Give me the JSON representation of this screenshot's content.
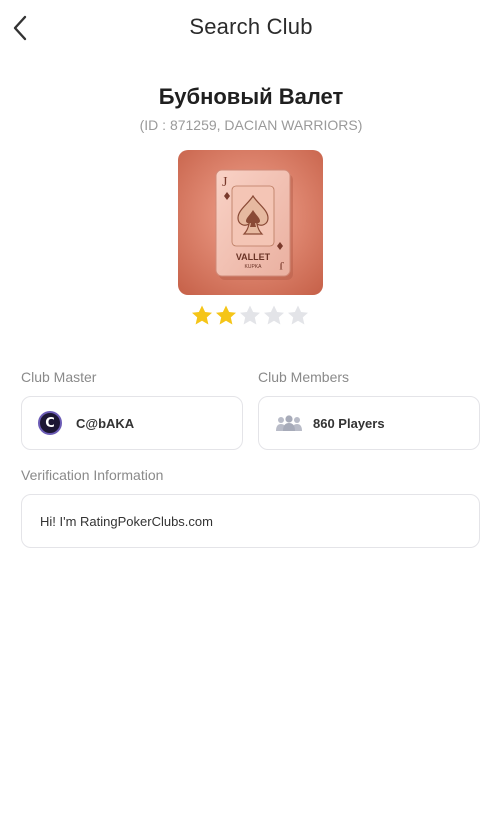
{
  "header": {
    "title": "Search Club"
  },
  "club": {
    "name": "Бубновый Валет",
    "id_line": "(ID : 871259, DACIAN WARRIORS)",
    "image_text": "VALLET",
    "image_subtext": "KUPKA",
    "rating": 2,
    "rating_max": 5
  },
  "master": {
    "label": "Club Master",
    "name": "C@bAKA",
    "avatar_letter": "C"
  },
  "members": {
    "label": "Club Members",
    "count": "860 Players"
  },
  "verification": {
    "label": "Verification Information",
    "text": "Hi! I'm RatingPokerClubs.com"
  },
  "colors": {
    "star_filled": "#f5c518",
    "star_empty": "#e3e4e8",
    "border": "#e4e4e8"
  },
  "icons": {
    "back": "chevron-left-icon",
    "members": "people-group-icon"
  }
}
